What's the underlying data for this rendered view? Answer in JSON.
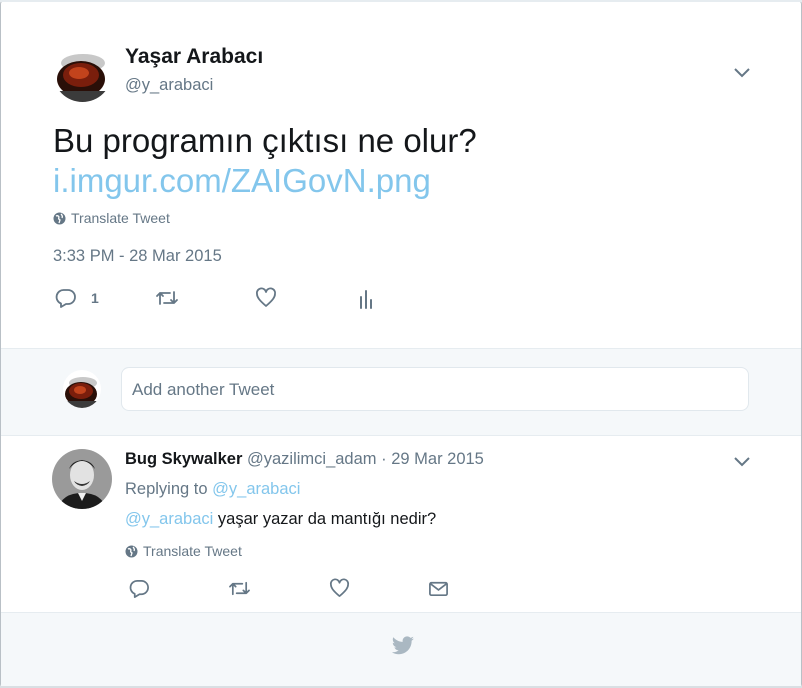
{
  "tweet": {
    "author_name": "Yaşar Arabacı",
    "author_handle": "@y_arabaci",
    "text": "Bu programın çıktısı ne olur?",
    "link": "i.imgur.com/ZAIGovN.png",
    "translate_label": "Translate Tweet",
    "timestamp": "3:33 PM - 28 Mar 2015",
    "reply_count": "1"
  },
  "compose": {
    "placeholder": "Add another Tweet"
  },
  "reply": {
    "author_name": "Bug Skywalker",
    "author_handle": "@yazilimci_adam",
    "separator": "·",
    "date": "29 Mar 2015",
    "replying_prefix": "Replying to",
    "replying_to": "@y_arabaci",
    "mention": "@y_arabaci",
    "text": "yaşar yazar da mantığı nedir?",
    "translate_label": "Translate Tweet"
  },
  "icons": {
    "caret": "chevron-down-icon",
    "translate": "globe-icon",
    "reply": "reply-icon",
    "retweet": "retweet-icon",
    "like": "heart-icon",
    "analytics": "analytics-icon",
    "dm": "envelope-icon",
    "footer": "twitter-bird-icon"
  },
  "colors": {
    "link": "#83c6ec",
    "secondary_text": "#657786",
    "primary_text": "#14171a",
    "panel_bg": "#f5f8fa"
  }
}
